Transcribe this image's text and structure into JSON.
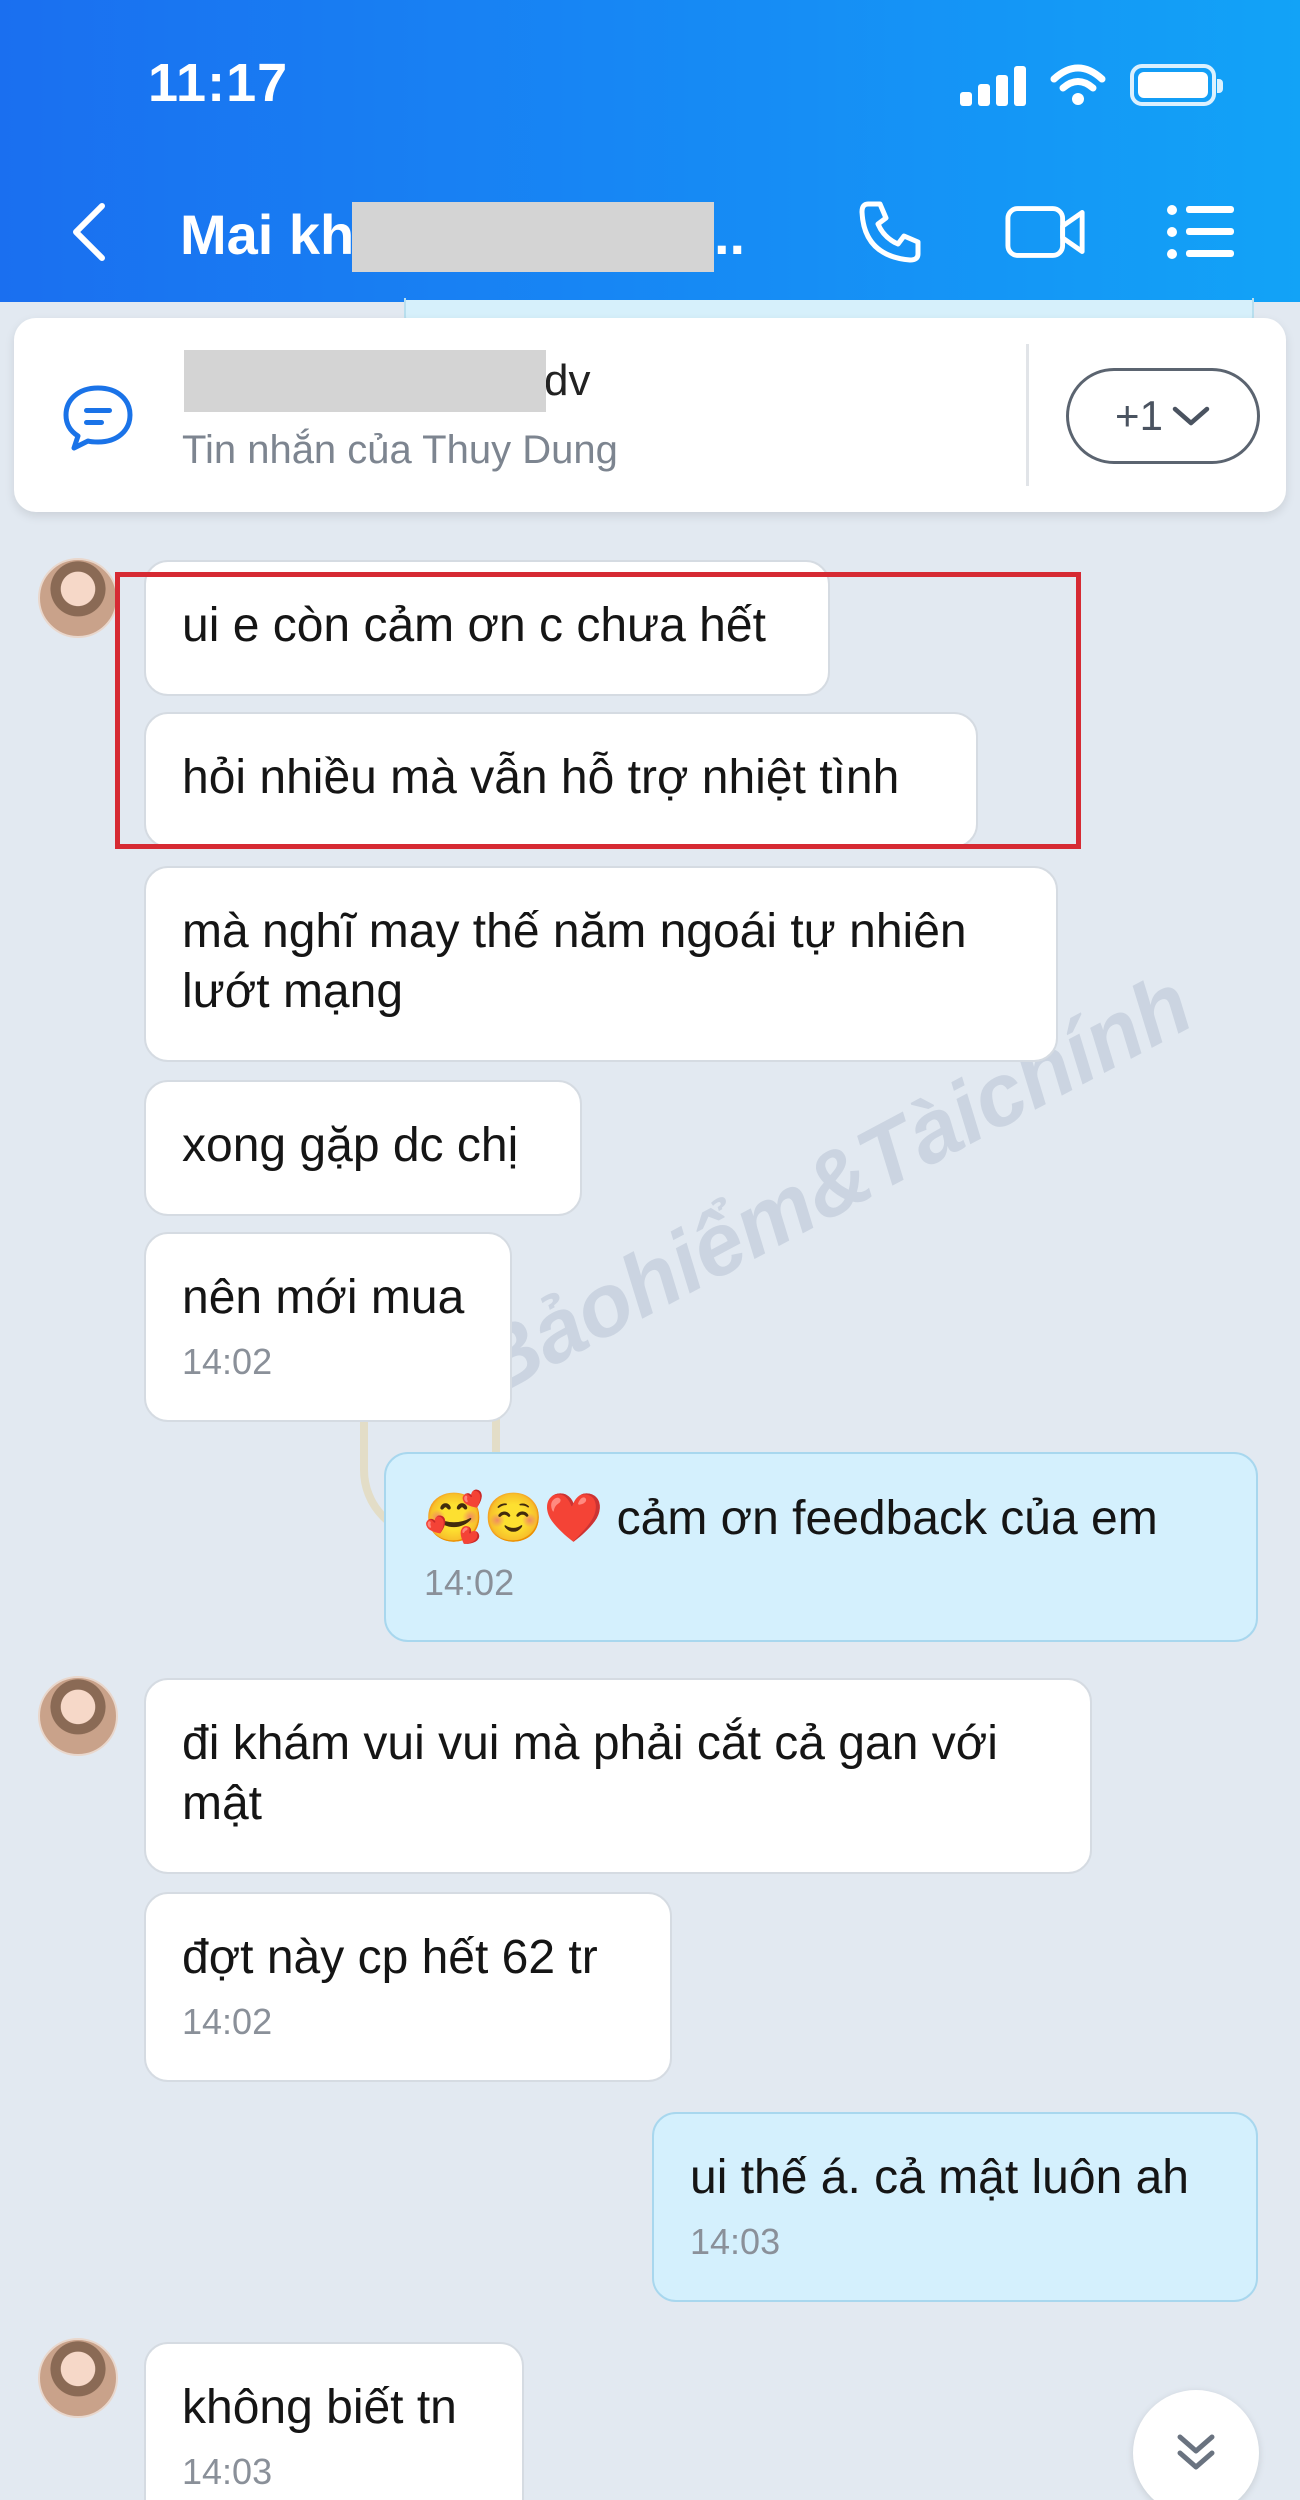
{
  "status_bar": {
    "time": "11:17"
  },
  "header": {
    "title": "Mai kh",
    "title_suffix": "..",
    "icons": [
      "back-icon",
      "phone-icon",
      "video-call-icon",
      "menu-list-icon"
    ]
  },
  "pinned": {
    "title_tail": "dv",
    "subtitle": "Tin nhắn của Thuy Dung",
    "more_label": "+1"
  },
  "messages": [
    {
      "text": "ui e còn cảm ơn c chưa hết"
    },
    {
      "text": "hỏi nhiều mà vẫn hỗ trợ nhiệt tình"
    },
    {
      "text": "mà nghĩ may thế năm ngoái tự nhiên lướt mạng"
    },
    {
      "text": "xong gặp dc chị"
    },
    {
      "text": "nên mới mua",
      "time": "14:02"
    },
    {
      "emoji": "🥰☺️❤️",
      "text": " cảm ơn feedback của em",
      "time": "14:02"
    },
    {
      "text": "đi khám vui vui mà phải cắt cả gan với mật"
    },
    {
      "text": "đợt này cp hết 62 tr",
      "time": "14:02"
    },
    {
      "text": "ui thế á. cả mật luôn ah",
      "time": "14:03"
    },
    {
      "text": "không biết tn",
      "time": "14:03"
    }
  ],
  "watermark": "Bảohiểm&Tàichính"
}
